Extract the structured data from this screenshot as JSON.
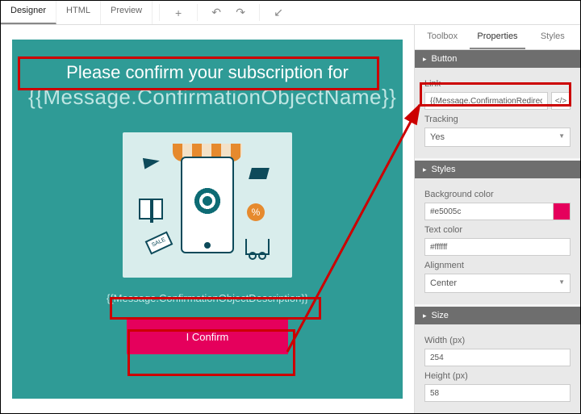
{
  "topbar": {
    "tabs": {
      "designer": "Designer",
      "html": "HTML",
      "preview": "Preview"
    }
  },
  "canvas": {
    "headline": "Please confirm your subscription for",
    "placeholder_name": "{{Message.ConfirmationObjectName}}",
    "placeholder_desc": "{{Message.ConfirmationObjectDescription}}",
    "confirm_label": "I Confirm",
    "sale_tag": "SALE",
    "percent_badge": "%"
  },
  "side": {
    "tabs": {
      "toolbox": "Toolbox",
      "properties": "Properties",
      "styles": "Styles"
    },
    "section_button": "Button",
    "link_label": "Link",
    "link_value": "{{Message.ConfirmationRedirectURL}}",
    "tracking_label": "Tracking",
    "tracking_value": "Yes",
    "section_styles": "Styles",
    "bgcolor_label": "Background color",
    "bgcolor_value": "#e5005c",
    "textcolor_label": "Text color",
    "textcolor_value": "#ffffff",
    "alignment_label": "Alignment",
    "alignment_value": "Center",
    "section_size": "Size",
    "width_label": "Width (px)",
    "width_value": "254",
    "height_label": "Height (px)",
    "height_value": "58"
  }
}
